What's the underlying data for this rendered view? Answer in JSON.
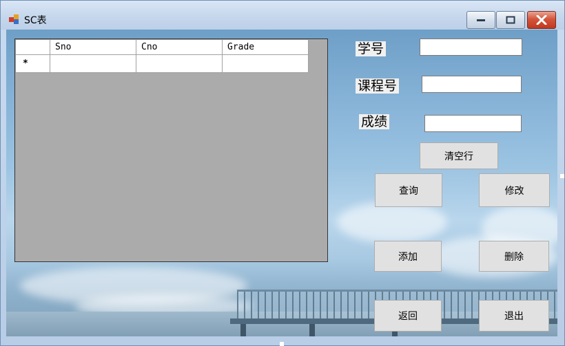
{
  "window": {
    "title": "SC表"
  },
  "grid": {
    "columns": [
      "Sno",
      "Cno",
      "Grade"
    ],
    "new_row_marker": "*",
    "rows": [
      {
        "cells": [
          "",
          "",
          ""
        ]
      }
    ]
  },
  "form": {
    "sno_label": "学号",
    "cno_label": "课程号",
    "grade_label": "成绩",
    "sno_value": "",
    "cno_value": "",
    "grade_value": ""
  },
  "buttons": {
    "clear": "清空行",
    "query": "查询",
    "modify": "修改",
    "add": "添加",
    "delete": "删除",
    "back": "返回",
    "exit": "退出"
  }
}
